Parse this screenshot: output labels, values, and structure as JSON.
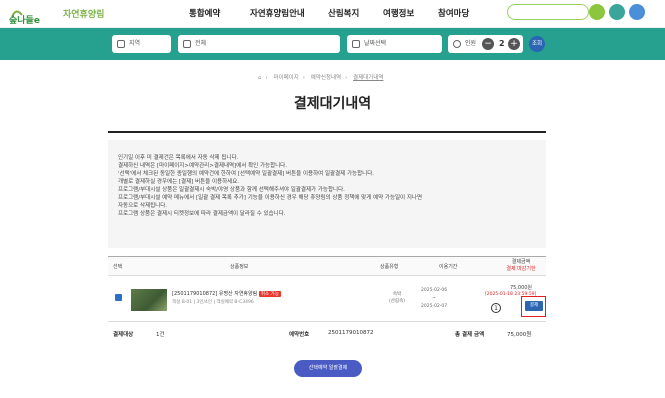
{
  "header": {
    "logo_text": "숲나들e",
    "subtitle": "자연휴양림",
    "nav": [
      "통합예약",
      "자연휴양림안내",
      "산림복지",
      "여행정보",
      "참여마당"
    ]
  },
  "search": {
    "region_placeholder": "지역",
    "forest_value": "전체",
    "date_placeholder": "날짜선택",
    "people_label": "인원",
    "count": "2",
    "go_label": "조회"
  },
  "breadcrumb": [
    "⌂",
    "마이페이지",
    "예약신청내역",
    "결제대기내역"
  ],
  "page_title": "결제대기내역",
  "info_lines": [
    "인기일 이후 미 결제건은 목록에서 자동 삭제 됩니다.",
    "결제하신 내역은 [마이페이지>예약관리>결제내역]에서 확인 가능합니다.",
    "'선택'에서 체크된 동일한 종일행의 예약건에 한하여 [선택예약 일괄결제] 버튼을 이용하여 일괄결제 가능합니다.",
    "개별로 결제하실 경우에는 [결제] 버튼을 이용하세요.",
    "프로그램/부대시설 상품은 일괄결제시 숙박/야영 상품과 함께 선택해주셔야 일괄결제가 가능합니다.",
    "프로그램/부대시설 예약 메뉴에서 [일괄 결제 목록 추가] 기능을 이용하신 경우 해당 휴양림의 상품 정책에 맞게 예약 가능일이 지나면",
    "자동으로 삭제됩니다.",
    "프로그램 상품은 결제시 티켓정보에 따라 결제금액이 달라질 수 있습니다."
  ],
  "table": {
    "headers": {
      "select": "선택",
      "product": "상품정보",
      "type": "상품유형",
      "period": "이용기간",
      "pay_amount": "결제금액",
      "pay_deadline": "결제 마감기한"
    },
    "row": {
      "reservation": "[2501179010872] 유명산 자연휴양림",
      "badge": "취소 가능",
      "detail": "객실 B-01 | 3인/4인 | 객실예약 B-C3496",
      "type_line1": "숙박",
      "type_line2": "(산림숙)",
      "period_start": "2025-02-06",
      "period_sep": "~",
      "period_end": "2025-02-07",
      "amount": "75,000원",
      "deadline": "[2025-01-18 23:59:59]",
      "pay_button": "결제"
    }
  },
  "marker": "1",
  "summary": {
    "label_count": "결제대상",
    "count": "1건",
    "label_no": "예약번호",
    "number": "2501179010872",
    "label_total": "총 결제 금액",
    "total": "75,000원"
  },
  "bulk_button": "선택예약 일괄결제",
  "colors": {
    "bar": "#26a08f",
    "accent": "#2c66b3",
    "warn": "#e02020"
  }
}
